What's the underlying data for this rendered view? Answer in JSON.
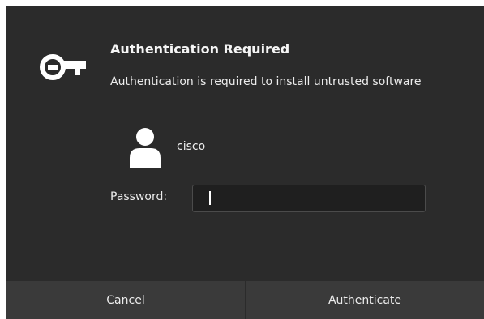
{
  "dialog": {
    "title": "Authentication Required",
    "message": "Authentication is required to install untrusted software",
    "icon": "key-icon"
  },
  "user": {
    "name": "cisco",
    "icon": "user-avatar-icon"
  },
  "password": {
    "label": "Password:",
    "value": ""
  },
  "buttons": {
    "cancel": "Cancel",
    "authenticate": "Authenticate"
  },
  "colors": {
    "dialog_background": "#2b2b2b",
    "button_bar": "#3a3a3a",
    "text": "#ececec",
    "input_background": "#1f1f1f"
  }
}
